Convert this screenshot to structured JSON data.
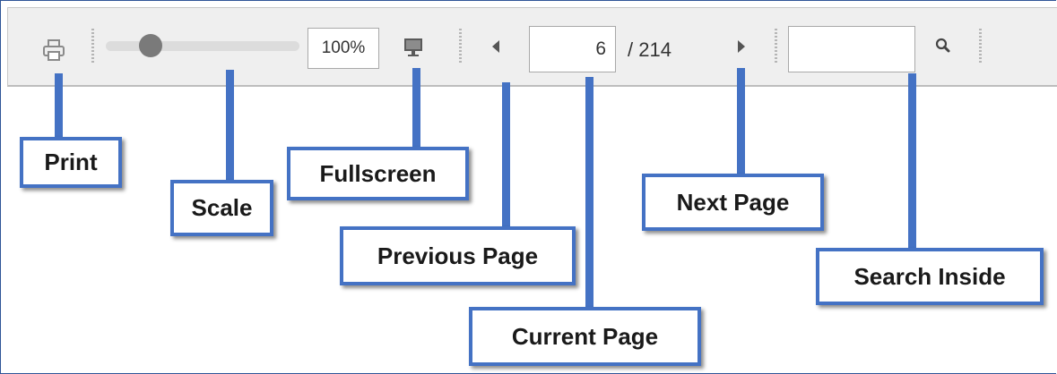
{
  "toolbar": {
    "zoom_value": "100%",
    "current_page": "6",
    "total_pages": "/ 214",
    "search_value": "",
    "icons": {
      "print": "print-icon",
      "fullscreen": "monitor-icon",
      "previous": "triangle-left-icon",
      "next": "triangle-right-icon",
      "search": "magnifier-icon"
    }
  },
  "labels": {
    "print": "Print",
    "scale": "Scale",
    "fullscreen": "Fullscreen",
    "previous_page": "Previous Page",
    "current_page": "Current Page",
    "next_page": "Next Page",
    "search_inside": "Search Inside"
  },
  "colors": {
    "callout": "#4472c4",
    "toolbar_bg": "#efefef",
    "icon": "#6f6f6f"
  }
}
